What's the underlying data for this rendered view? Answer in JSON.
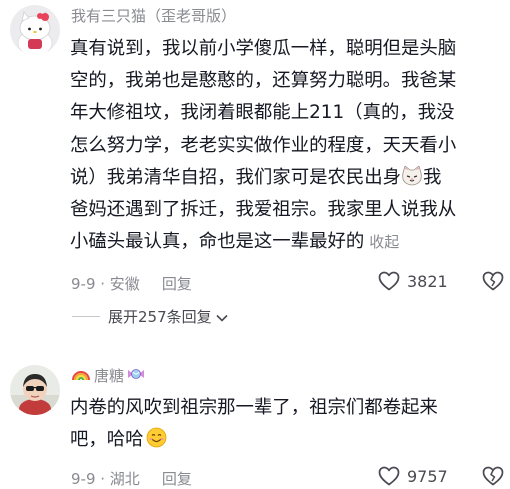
{
  "comment1": {
    "username": "我有三只猫（歪老哥版）",
    "lines_before_emoji": [
      "真有说到，我以前小学傻瓜一样，聪明但是头脑",
      "空的，我弟也是憨憨的，还算努力聪明。我爸某",
      "年大修祖坟，我闭着眼都能上211（真的，我没",
      "怎么努力学，老老实实做作业的程度，天天看小"
    ],
    "line5_pre": "说）我弟清华自招，我们家可是农民出身",
    "line5_post": "我",
    "lines_after_emoji": [
      "爸妈还遇到了拆迁，我爱祖宗。我家里人说我从"
    ],
    "last_line": "小磕头最认真，命也是这一辈最好的",
    "collapse_label": "收起",
    "date_location": "9-9 · 安徽",
    "reply_label": "回复",
    "like_count": "3821",
    "icons": {
      "like": "heart-icon",
      "dislike": "broken-heart-icon",
      "emoji": "cat-face-emoji"
    }
  },
  "expand_replies_label": "展开257条回复",
  "comment2": {
    "username": "唐糖",
    "text_lines": [
      "内卷的风吹到祖宗那一辈了，祖宗们都卷起来",
      "吧，哈哈"
    ],
    "date_location": "9-9 · 湖北",
    "reply_label": "回复",
    "like_count": "9757",
    "icons": {
      "rainbow": "rainbow-emoji",
      "candy": "candy-emoji",
      "smile": "smiling-face-emoji"
    }
  },
  "colors": {
    "text": "#161823",
    "meta": "#8a8b91",
    "action": "#4a4b52"
  }
}
